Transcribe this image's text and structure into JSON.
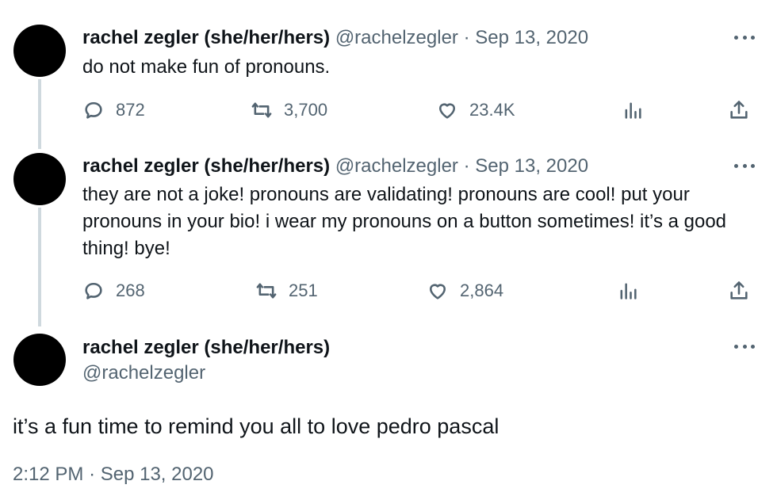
{
  "tweets": [
    {
      "name": "rachel zegler (she/her/hers)",
      "handle": "@rachelzegler",
      "separator": "·",
      "date": "Sep 13, 2020",
      "text": "do not make fun of pronouns.",
      "replies": "872",
      "retweets": "3,700",
      "likes": "23.4K"
    },
    {
      "name": "rachel zegler (she/her/hers)",
      "handle": "@rachelzegler",
      "separator": "·",
      "date": "Sep 13, 2020",
      "text": "they are not a joke! pronouns are validating! pronouns are cool! put your pronouns in your bio! i wear my pronouns on a button sometimes! it’s a good thing! bye!",
      "replies": "268",
      "retweets": "251",
      "likes": "2,864"
    }
  ],
  "main_tweet": {
    "name": "rachel zegler (she/her/hers)",
    "handle": "@rachelzegler",
    "text": "it’s a fun time to remind you all to love pedro pascal",
    "time": "2:12 PM",
    "separator": "·",
    "date": "Sep 13, 2020"
  },
  "icons": {
    "reply": "reply-icon",
    "retweet": "retweet-icon",
    "like": "heart-icon",
    "views": "views-icon",
    "share": "share-icon",
    "more": "more-icon"
  },
  "colors": {
    "text": "#0f1419",
    "secondary": "#536471",
    "thread_line": "#cfd9de"
  }
}
